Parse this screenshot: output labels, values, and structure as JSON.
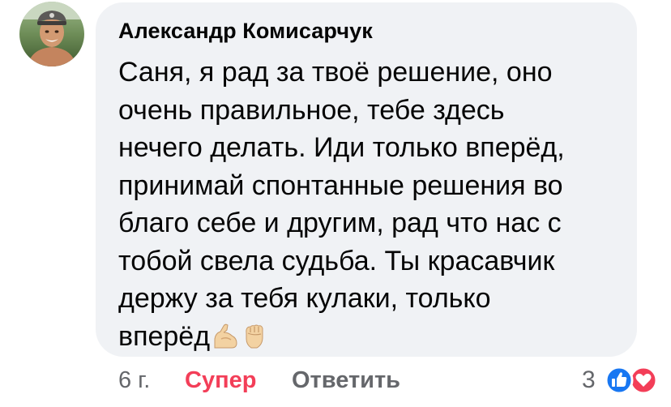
{
  "comment": {
    "author": "Александр Комисарчук",
    "lines": [
      "Саня, я рад за твоё решение, оно",
      "очень правильное, тебе здесь",
      "нечего делать. Иди только вперёд,",
      "принимай спонтанные решения во",
      "благо себе и другим, рад что нас с",
      "тобой свела судьба. Ты красавчик",
      "держу за тебя кулаки, только",
      "вперёд"
    ],
    "emojis": [
      "flexed-biceps-icon",
      "raised-fist-icon"
    ]
  },
  "footer": {
    "time": "6 г.",
    "reaction_label": "Супер",
    "reply_label": "Ответить",
    "reaction_count": "3",
    "reaction_icons": [
      "like-icon",
      "love-icon"
    ]
  },
  "colors": {
    "bubble": "#f0f2f5",
    "super": "#f33e58",
    "muted": "#65676b",
    "like": "#1877f2",
    "love": "#f33e58"
  }
}
